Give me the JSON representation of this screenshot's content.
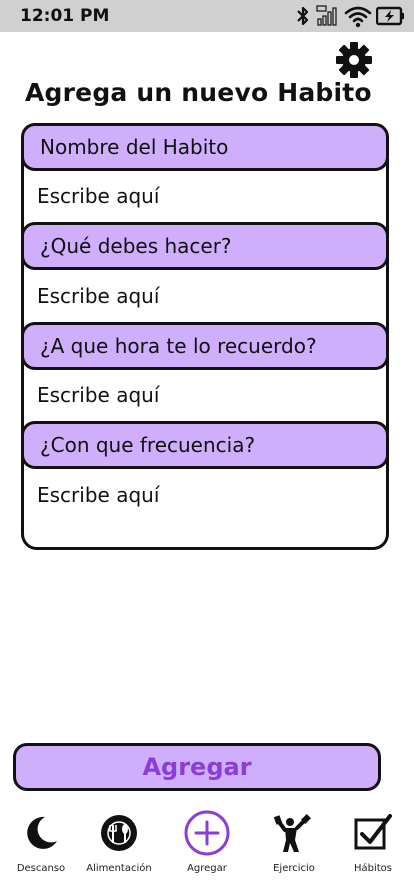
{
  "status_bar": {
    "time": "12:01 PM",
    "icons": [
      "bluetooth-icon",
      "signal-icon",
      "wifi-icon",
      "battery-icon"
    ]
  },
  "settings": {
    "icon": "gear-icon"
  },
  "page": {
    "title": "Agrega un nuevo Habito"
  },
  "form": {
    "fields": [
      {
        "label": "Nombre del Habito",
        "placeholder": "Escribe aquí"
      },
      {
        "label": "¿Qué debes hacer?",
        "placeholder": "Escribe aquí"
      },
      {
        "label": "¿A que hora te lo recuerdo?",
        "placeholder": "Escribe aquí"
      },
      {
        "label": "¿Con que frecuencia?",
        "placeholder": "Escribe aquí"
      }
    ]
  },
  "actions": {
    "add_label": "Agregar"
  },
  "nav": {
    "items": [
      {
        "label": "Descanso",
        "icon": "moon-icon"
      },
      {
        "label": "Alimentación",
        "icon": "plate-icon"
      },
      {
        "label": "Agregar",
        "icon": "plus-circle-icon"
      },
      {
        "label": "Ejercicio",
        "icon": "weightlifter-icon"
      },
      {
        "label": "Hábitos",
        "icon": "checkbox-icon"
      }
    ]
  },
  "colors": {
    "accent": "#cfaefb",
    "accent_text": "#8a3ed8",
    "status_bar": "#d0d0d0",
    "border": "#111111"
  }
}
